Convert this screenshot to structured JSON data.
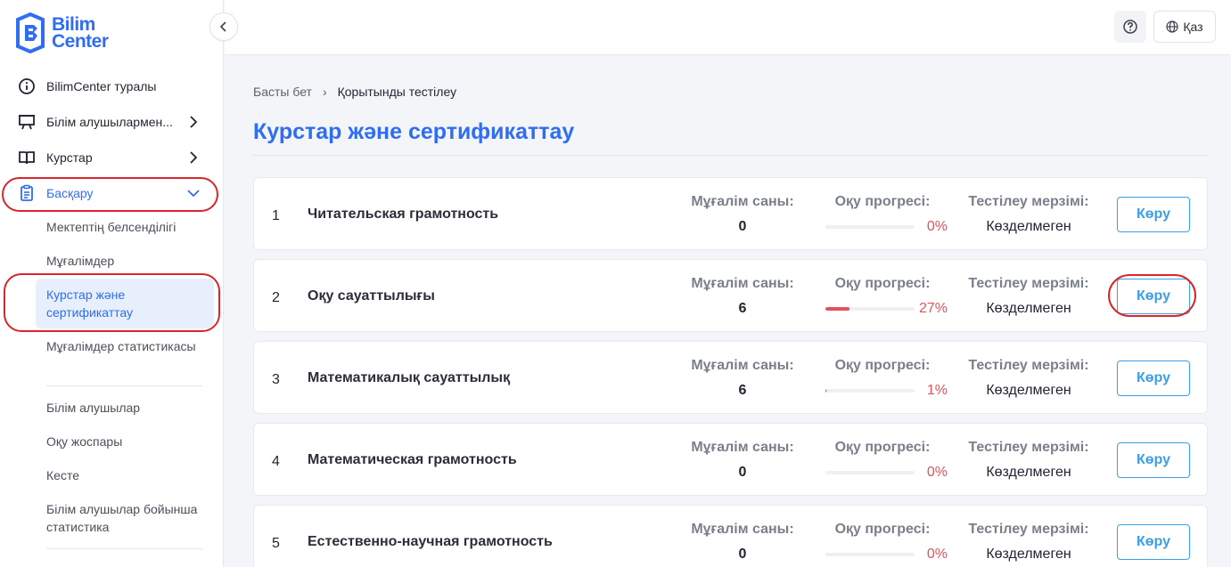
{
  "brand": {
    "line1": "Bilim",
    "line2": "Center",
    "color": "#2f6df1"
  },
  "sidebar": {
    "items": [
      {
        "label": "BilimCenter туралы",
        "icon": "info-icon"
      },
      {
        "label": "Білім алушылармен...",
        "icon": "presentation-icon"
      },
      {
        "label": "Курстар",
        "icon": "book-icon"
      },
      {
        "label": "Басқару",
        "icon": "clipboard-icon"
      }
    ],
    "subitems": [
      {
        "label": "Мектептің белсенділігі"
      },
      {
        "label": "Мұғалімдер"
      },
      {
        "label": "Курстар және сертификаттау"
      },
      {
        "label": "Мұғалімдер статистикасы"
      },
      {
        "label": "Білім алушылар"
      },
      {
        "label": "Оқу жоспары"
      },
      {
        "label": "Кесте"
      },
      {
        "label": "Білім алушылар бойынша статистика"
      }
    ]
  },
  "topbar": {
    "help_icon": "question-icon",
    "language": "Қаз",
    "language_icon": "globe-icon"
  },
  "breadcrumb": {
    "home": "Басты бет",
    "separator": "›",
    "current": "Қорытынды тестілеу"
  },
  "page_title": "Курстар және сертификаттау",
  "labels": {
    "teachers": "Мұғалім саны:",
    "progress": "Оқу прогресі:",
    "deadline": "Тестілеу мерзімі:",
    "view": "Көру"
  },
  "courses": [
    {
      "num": "1",
      "name": "Читательская грамотность",
      "teachers": "0",
      "progress_text": "0%",
      "progress": 0,
      "deadline": "Көзделмеген"
    },
    {
      "num": "2",
      "name": "Оқу сауаттылығы",
      "teachers": "6",
      "progress_text": "27%",
      "progress": 27,
      "deadline": "Көзделмеген"
    },
    {
      "num": "3",
      "name": "Математикалық сауаттылық",
      "teachers": "6",
      "progress_text": "1%",
      "progress": 1,
      "deadline": "Көзделмеген"
    },
    {
      "num": "4",
      "name": "Математическая грамотность",
      "teachers": "0",
      "progress_text": "0%",
      "progress": 0,
      "deadline": "Көзделмеген"
    },
    {
      "num": "5",
      "name": "Естественно-научная грамотность",
      "teachers": "0",
      "progress_text": "0%",
      "progress": 0,
      "deadline": "Көзделмеген"
    }
  ],
  "colors": {
    "accent": "#2f6df1",
    "button": "#3aa0e6",
    "progress": "#e5505f",
    "highlight": "#d9252b"
  }
}
